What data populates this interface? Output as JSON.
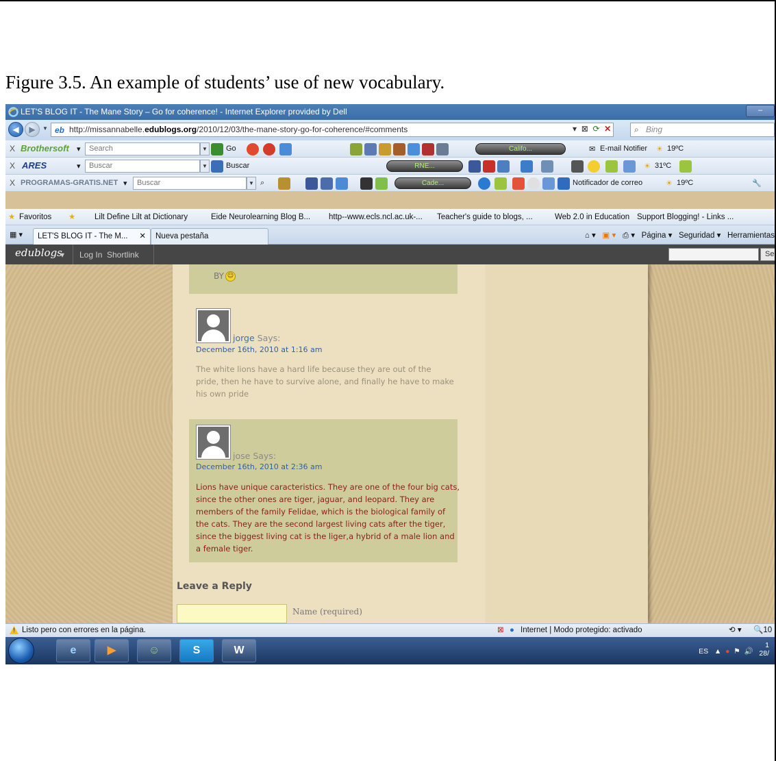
{
  "caption": "Figure 3.5. An example of students’ use of new vocabulary.",
  "window": {
    "title": "LET'S BLOG IT - The Mane Story – Go for coherence! - Internet Explorer provided by Dell",
    "url_prefix": "http://missannabelle.",
    "url_domain": "edublogs.org",
    "url_path": "/2010/12/03/the-mane-story-go-for-coherence/#comments",
    "search_placeholder": "Bing"
  },
  "toolbars": {
    "brothersoft": {
      "brand": "Brothersoft",
      "search_placeholder": "Search",
      "go_label": "Go",
      "player_label": "Califo...",
      "email_label": "E-mail Notifier",
      "temp": "19ºC"
    },
    "ares": {
      "brand": "ARES",
      "search_placeholder": "Buscar",
      "search_button": "Buscar",
      "player_label": "RNE...",
      "temp": "31ºC"
    },
    "programas": {
      "brand": "PROGRAMAS-GRATIS.NET",
      "search_placeholder": "Buscar",
      "player_label": "Cade...",
      "email_label": "Notificador de correo",
      "temp": "19ºC"
    }
  },
  "favorites": {
    "label": "Favoritos",
    "items": [
      "Lilt Define Lilt at Dictionary",
      "Eide Neurolearning Blog B...",
      "http--www.ecls.ncl.ac.uk-...",
      "Teacher's guide to blogs, ...",
      "Web 2.0 in Education",
      "Support Blogging! - Links ..."
    ]
  },
  "tabs": {
    "active": "LET'S BLOG IT - The M...",
    "second": "Nueva pestaña",
    "commands": {
      "page": "Página",
      "security": "Seguridad",
      "tools": "Herramientas"
    }
  },
  "edubar": {
    "logo": "edublogs",
    "login": "Log In",
    "shortlink": "Shortlink",
    "search_button": "Se"
  },
  "comments": {
    "prev_fragment": "BY",
    "items": [
      {
        "author": "jorge",
        "says": "Says:",
        "date": "December 16th, 2010 at 1:16 am",
        "text": "The white lions have a hard life because they are out of the pride, then he have to survive alone, and finally he have to make his own pride"
      },
      {
        "author": "jose",
        "says": "Says:",
        "date": "December 16th, 2010 at 2:36 am",
        "text": "Lions have unique caracteristics. They are one of the four big cats, since the other ones are tiger, jaguar, and leopard. They are members of the family Felidae, which is the biological family of the cats. They are the second largest living cats after the tiger, since the biggest living cat is the liger,a hybrid of a male lion and a female tiger."
      }
    ],
    "leave_reply": "Leave a Reply",
    "name_label": "Name (required)"
  },
  "status": {
    "message": "Listo pero con errores en la página.",
    "zone": "Internet | Modo protegido: activado",
    "zoom": "10"
  },
  "taskbar": {
    "lang": "ES",
    "time": "1",
    "date": "28/"
  }
}
